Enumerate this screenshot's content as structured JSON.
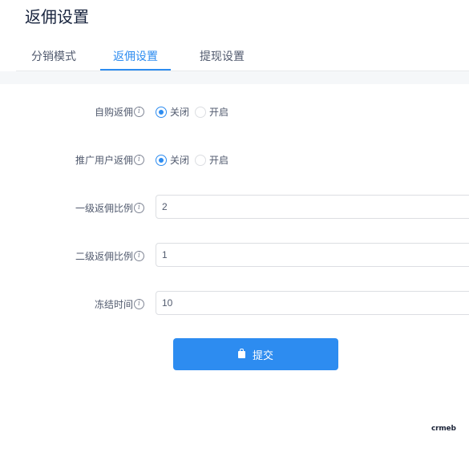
{
  "page": {
    "title": "返佣设置"
  },
  "tabs": [
    {
      "label": "分销模式",
      "active": false
    },
    {
      "label": "返佣设置",
      "active": true
    },
    {
      "label": "提现设置",
      "active": false
    }
  ],
  "form": {
    "self_purchase": {
      "label": "自购返佣",
      "options": [
        "关闭",
        "开启"
      ],
      "selected": "关闭"
    },
    "promoter_rebate": {
      "label": "推广用户返佣",
      "options": [
        "关闭",
        "开启"
      ],
      "selected": "关闭"
    },
    "level1_ratio": {
      "label": "一级返佣比例",
      "value": "2"
    },
    "level2_ratio": {
      "label": "二级返佣比例",
      "value": "1"
    },
    "freeze_time": {
      "label": "冻结时间",
      "value": "10"
    },
    "submit_label": "提交"
  },
  "brand": {
    "text": "crmeb"
  },
  "colors": {
    "accent": "#2d8cf0",
    "text": "#515a6e",
    "border": "#dcdee2"
  },
  "icons": {
    "info": "info-circle-icon",
    "submit": "lock-icon"
  }
}
